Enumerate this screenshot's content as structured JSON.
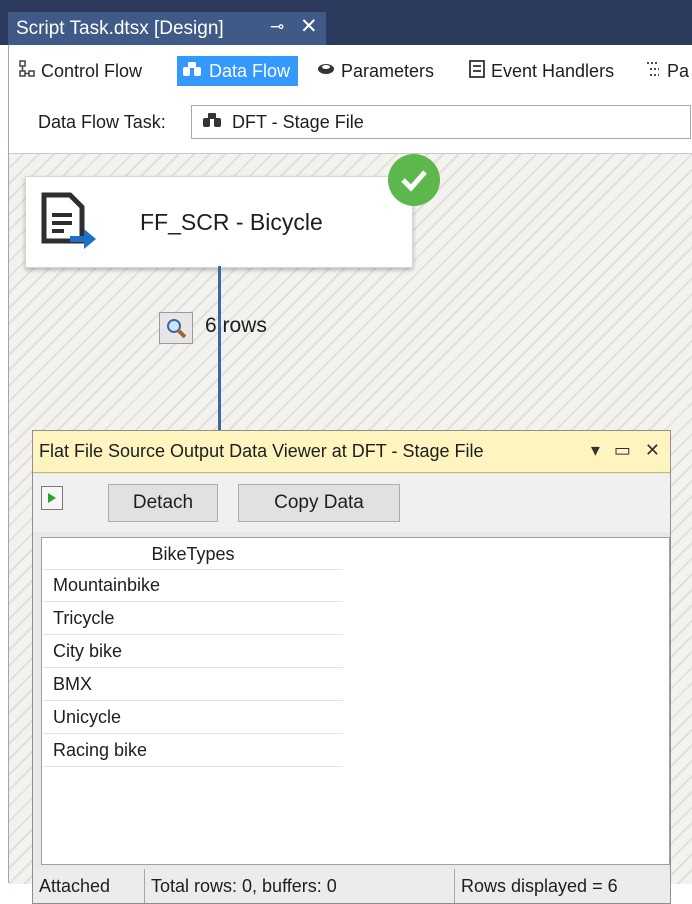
{
  "document_tab": {
    "title": "Script Task.dtsx [Design]",
    "pin_glyph": "⊸",
    "close_glyph": "✕"
  },
  "designer_tabs": [
    {
      "label": "Control Flow",
      "icon": "control-flow-icon",
      "active": false
    },
    {
      "label": "Data Flow",
      "icon": "data-flow-icon",
      "active": true
    },
    {
      "label": "Parameters",
      "icon": "parameters-icon",
      "active": false
    },
    {
      "label": "Event Handlers",
      "icon": "event-handlers-icon",
      "active": false
    },
    {
      "label": "Pa",
      "icon": "package-explorer-icon",
      "active": false
    }
  ],
  "task_selector": {
    "label": "Data Flow Task:",
    "value": "DFT - Stage File"
  },
  "component": {
    "name": "FF_SCR - Bicycle",
    "status": "success"
  },
  "path": {
    "rows_label": "6 rows"
  },
  "data_viewer": {
    "title": "Flat File Source Output Data Viewer at DFT - Stage File",
    "detach_label": "Detach",
    "copy_label": "Copy Data",
    "column_header": "BikeTypes",
    "rows": [
      "Mountainbike",
      "Tricycle",
      "City bike",
      "BMX",
      "Unicycle",
      "Racing bike"
    ],
    "status": {
      "state": "Attached",
      "totals": "Total rows: 0, buffers: 0",
      "displayed": "Rows displayed = 6"
    }
  },
  "colors": {
    "tab_strip_bg": "#2b3a5d",
    "active_tab_bg": "#3399ff",
    "success_green": "#5cb84d",
    "viewer_title_bg": "#fdf4c0"
  }
}
